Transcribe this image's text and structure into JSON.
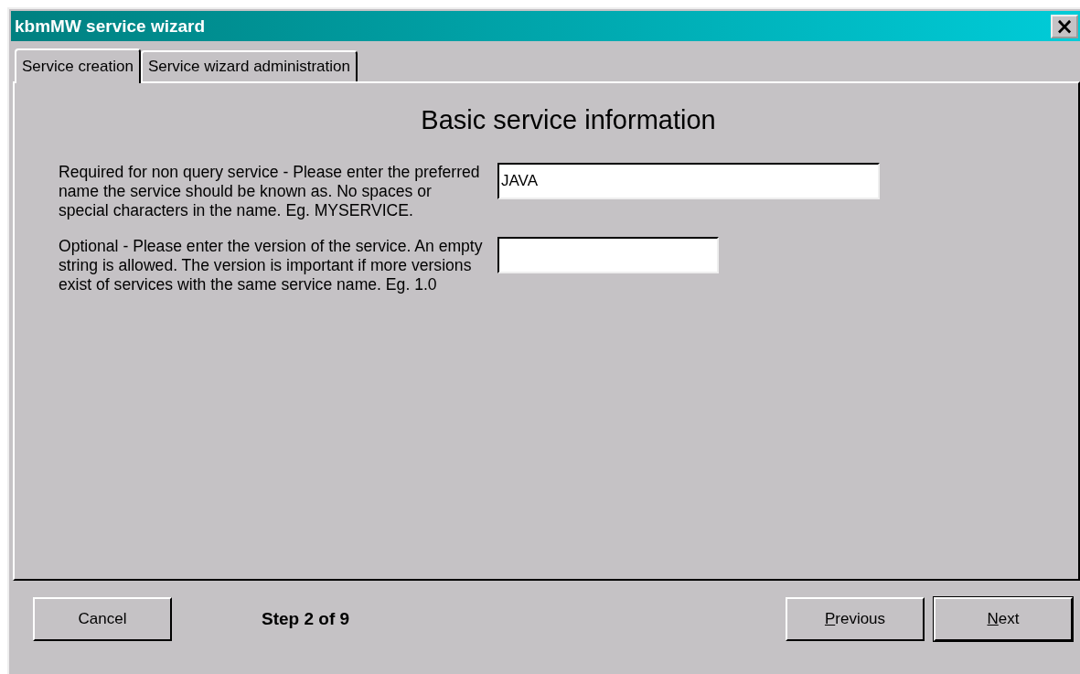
{
  "window": {
    "title": "kbmMW service wizard",
    "close": "×"
  },
  "tabs": [
    {
      "label": "Service creation",
      "selected": true
    },
    {
      "label": "Service wizard administration",
      "selected": false
    }
  ],
  "heading": "Basic service information",
  "fields": [
    {
      "description": "Required for non query service - Please enter the preferred name the service should be known as. No spaces or special characters in the name. Eg. MYSERVICE.",
      "value": "JAVA"
    },
    {
      "description": "Optional - Please enter the version of the service. An empty string is allowed. The version is important if more versions exist of services with the same service name. Eg. 1.0"
    }
  ],
  "footer": {
    "cancel": {
      "label": "Cancel"
    },
    "step": "Step 2 of 9",
    "buttons": [
      {
        "label": "Previous",
        "underline_first": true,
        "default": false
      },
      {
        "label": "Next",
        "underline_first": true,
        "default": true
      }
    ]
  }
}
